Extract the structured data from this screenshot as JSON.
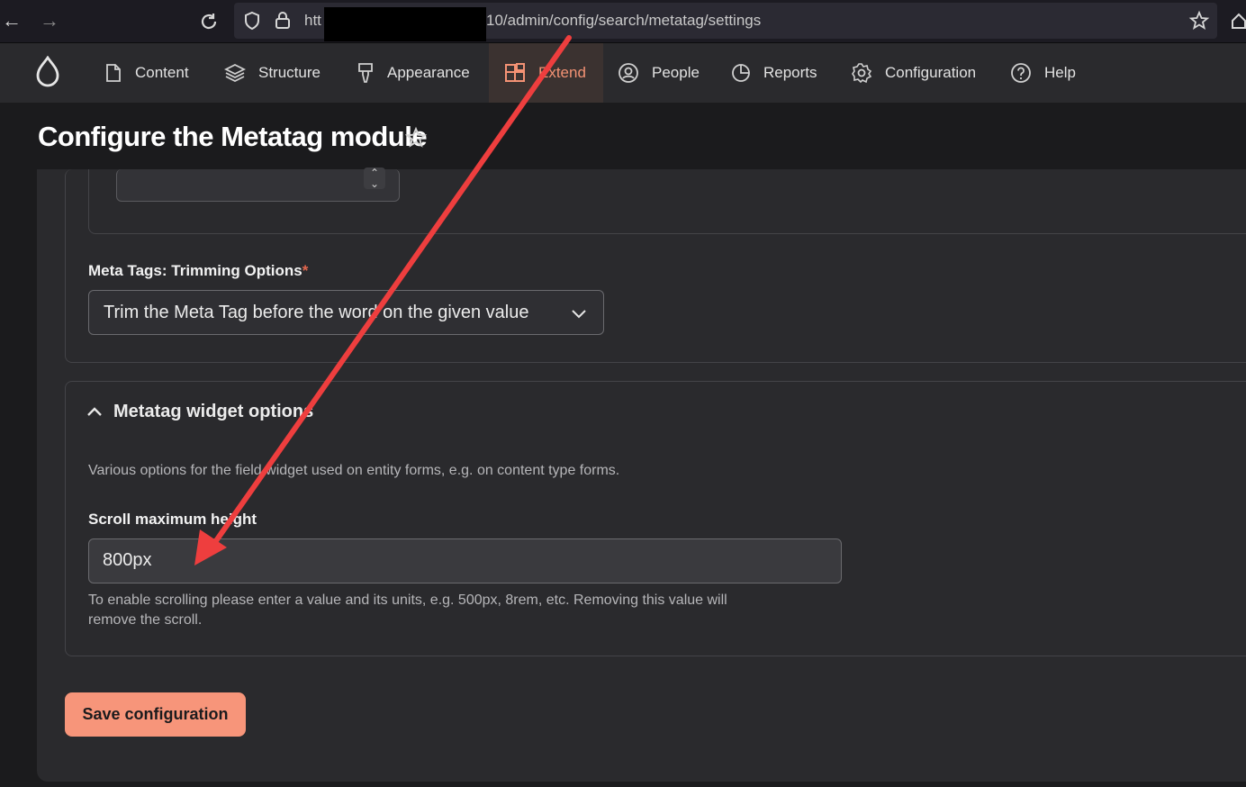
{
  "browser": {
    "url_prefix": "htt",
    "url_suffix": "10/admin/config/search/metatag/settings"
  },
  "toolbar": {
    "items": [
      {
        "label": "Content",
        "icon": "content-icon"
      },
      {
        "label": "Structure",
        "icon": "structure-icon"
      },
      {
        "label": "Appearance",
        "icon": "appearance-icon"
      },
      {
        "label": "Extend",
        "icon": "extend-icon",
        "active": true
      },
      {
        "label": "People",
        "icon": "people-icon"
      },
      {
        "label": "Reports",
        "icon": "reports-icon"
      },
      {
        "label": "Configuration",
        "icon": "configuration-icon"
      },
      {
        "label": "Help",
        "icon": "help-icon"
      }
    ]
  },
  "page": {
    "title": "Configure the Metatag module"
  },
  "trimming": {
    "label": "Meta Tags: Trimming Options",
    "required_mark": "*",
    "selected_value": "Trim the Meta Tag before the word on the given value"
  },
  "widget_options": {
    "legend": "Metatag widget options",
    "description": "Various options for the field widget used on entity forms, e.g. on content type forms.",
    "scroll_label": "Scroll maximum height",
    "scroll_value": "800px",
    "scroll_help": "To enable scrolling please enter a value and its units, e.g. 500px, 8rem, etc. Removing this value will remove the scroll."
  },
  "actions": {
    "save_label": "Save configuration"
  },
  "colors": {
    "accent": "#f7957a",
    "active_tab_text": "#f39274",
    "annotation_arrow": "#ee3e3e"
  }
}
